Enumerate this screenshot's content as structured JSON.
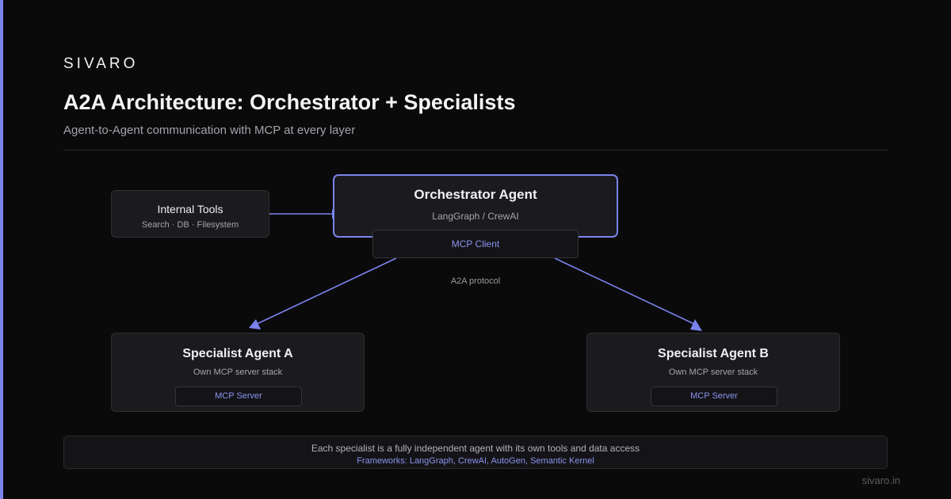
{
  "brand": "SIVARO",
  "title": "A2A Architecture: Orchestrator + Specialists",
  "subtitle": "Agent-to-Agent communication with MCP at every layer",
  "colors": {
    "accent": "#7b83eb",
    "background": "#0a0a0b",
    "box": "#1b1b1e"
  },
  "internal_tools": {
    "title": "Internal Tools",
    "subtitle": "Search · DB · Filesystem"
  },
  "orchestrator": {
    "title": "Orchestrator Agent",
    "subtitle": "LangGraph / CrewAI",
    "client_label": "MCP Client"
  },
  "protocol_label": "A2A protocol",
  "specialists": [
    {
      "title": "Specialist Agent A",
      "subtitle": "Own MCP server stack",
      "server_label": "MCP Server"
    },
    {
      "title": "Specialist Agent B",
      "subtitle": "Own MCP server stack",
      "server_label": "MCP Server"
    }
  ],
  "footer": {
    "line1": "Each specialist is a fully independent agent with its own tools and data access",
    "line2": "Frameworks: LangGraph, CrewAI, AutoGen, Semantic Kernel"
  },
  "site": "sivaro.in"
}
